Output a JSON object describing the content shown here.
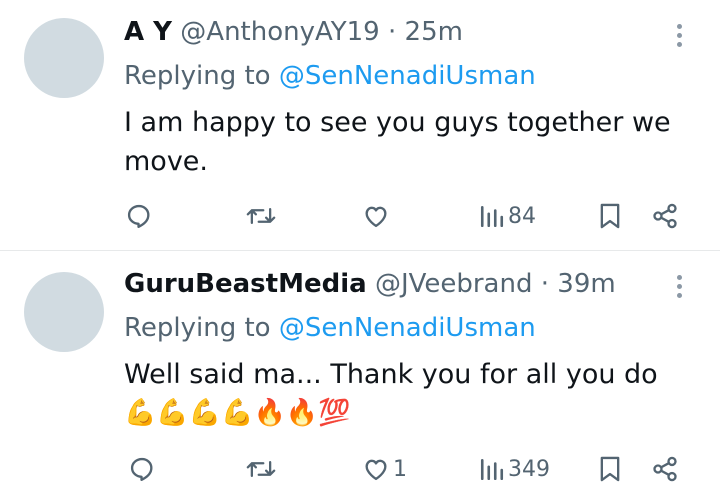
{
  "tweets": [
    {
      "name": "A Y",
      "handle": "@AnthonyAY19",
      "sep": "·",
      "time": "25m",
      "replying_label": "Replying to",
      "replying_to": "@SenNenadiUsman",
      "text_line1": "I am happy to see you guys together we",
      "text_line2": "move.",
      "likes": "",
      "views": "84"
    },
    {
      "name": "GuruBeastMedia",
      "handle": "@JVeebrand",
      "sep": "·",
      "time": "39m",
      "replying_label": "Replying to",
      "replying_to": "@SenNenadiUsman",
      "text_line1": "Well said ma... Thank you for all you do",
      "emojis": "💪💪💪💪🔥🔥💯",
      "likes": "1",
      "views": "349"
    }
  ],
  "icons": [
    "reply-icon",
    "retweet-icon",
    "like-icon",
    "views-icon",
    "bookmark-icon",
    "share-icon",
    "more-icon"
  ],
  "colors": {
    "link": "#1d9bf0",
    "secondary": "#536471",
    "avatar": "#d1dbe1",
    "divider": "#e7e9ea"
  }
}
